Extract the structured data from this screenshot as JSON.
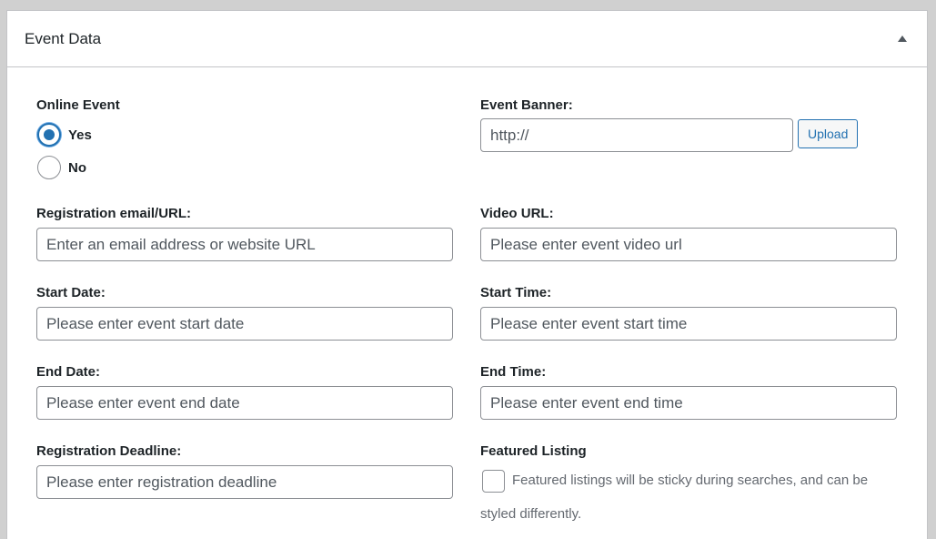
{
  "panel": {
    "title": "Event Data",
    "toggle_icon": "triangle-up-icon"
  },
  "online_event": {
    "label": "Online Event",
    "options": [
      {
        "label": "Yes",
        "selected": true
      },
      {
        "label": "No",
        "selected": false
      }
    ]
  },
  "event_banner": {
    "label": "Event Banner:",
    "value": "",
    "placeholder": "http://",
    "upload_label": "Upload"
  },
  "registration": {
    "label": "Registration email/URL:",
    "placeholder": "Enter an email address or website URL"
  },
  "video_url": {
    "label": "Video URL:",
    "placeholder": "Please enter event video url"
  },
  "start_date": {
    "label": "Start Date:",
    "placeholder": "Please enter event start date"
  },
  "start_time": {
    "label": "Start Time:",
    "placeholder": "Please enter event start time"
  },
  "end_date": {
    "label": "End Date:",
    "placeholder": "Please enter event end date"
  },
  "end_time": {
    "label": "End Time:",
    "placeholder": "Please enter event end time"
  },
  "deadline": {
    "label": "Registration Deadline:",
    "placeholder": "Please enter registration deadline"
  },
  "featured": {
    "label": "Featured Listing",
    "checked": false,
    "description": "Featured listings will be sticky during searches, and can be styled differently."
  },
  "colors": {
    "accent": "#2271b1",
    "border": "#8c8f94",
    "text": "#1d2327",
    "muted": "#646970"
  }
}
